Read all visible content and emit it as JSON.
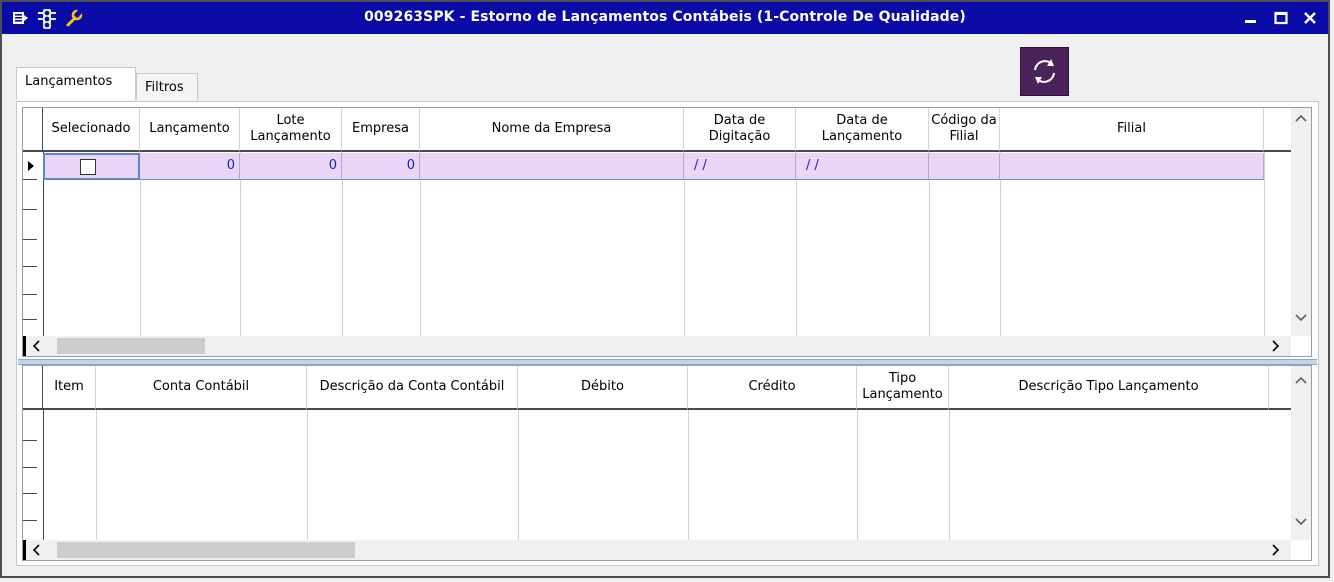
{
  "window": {
    "title": "009263SPK - Estorno de Lançamentos Contábeis (1-Controle De Qualidade)",
    "controls": [
      "minimize-icon",
      "maximize-icon",
      "close-icon"
    ],
    "title_icons": [
      "menu-icon",
      "traffic-light-icon",
      "wrench-icon"
    ],
    "colors": {
      "titlebar": "#0a0aa6",
      "accent": "#4a235a",
      "selected_row": "#ead5f7"
    }
  },
  "tabs": [
    {
      "label": "Lançamentos",
      "active": true
    },
    {
      "label": "Filtros",
      "active": false
    }
  ],
  "refresh_button": {
    "icon": "refresh-icon"
  },
  "top_grid": {
    "columns": [
      {
        "label": "Selecionado"
      },
      {
        "label": "Lançamento"
      },
      {
        "label": "Lote Lançamento"
      },
      {
        "label": "Empresa"
      },
      {
        "label": "Nome da Empresa"
      },
      {
        "label": "Data de Digitação"
      },
      {
        "label": "Data de Lançamento"
      },
      {
        "label": "Código da Filial"
      },
      {
        "label": "Filial"
      }
    ],
    "row": {
      "selecionado": false,
      "lancamento": "0",
      "lote": "0",
      "empresa": "0",
      "nome_empresa": "",
      "data_digitacao": "/ /",
      "data_lancamento": "/ /",
      "codigo_filial": "",
      "filial": ""
    }
  },
  "bottom_grid": {
    "columns": [
      {
        "label": "Item"
      },
      {
        "label": "Conta Contábil"
      },
      {
        "label": "Descrição da Conta Contábil"
      },
      {
        "label": "Débito"
      },
      {
        "label": "Crédito"
      },
      {
        "label": "Tipo Lançamento"
      },
      {
        "label": "Descrição Tipo Lançamento"
      }
    ]
  }
}
